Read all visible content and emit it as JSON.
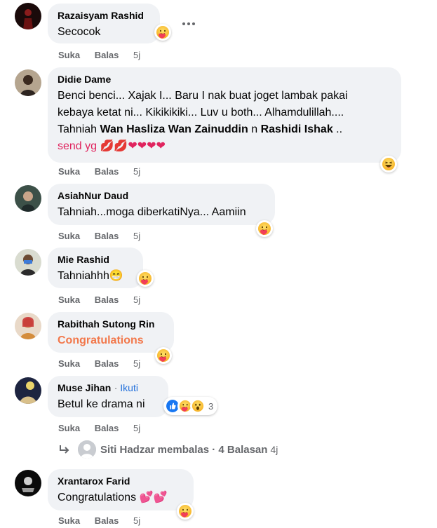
{
  "actions": {
    "like": "Suka",
    "reply": "Balas"
  },
  "comments": [
    {
      "author": "Razaisyam Rashid",
      "text": "Secocok",
      "time": "5j",
      "reaction": "care"
    },
    {
      "author": "Didie Dame",
      "text_lines": [
        "Benci benci... Xajak I... Baru I nak buat joget lambak pakai",
        "kebaya ketat ni... Kikikikiki... Luv u both... Alhamdulillah....",
        "Tahniah ",
        "Wan Hasliza Wan Zainuddin",
        " n ",
        "Rashidi Ishak",
        " ..",
        "send yg 💋💋❤❤❤❤"
      ],
      "time": "5j",
      "reaction": "haha"
    },
    {
      "author": "AsiahNur Daud",
      "text": "Tahniah...moga diberkatiNya... Aamiin",
      "time": "5j",
      "reaction": "care"
    },
    {
      "author": "Mie Rashid",
      "text": "Tahniahhh😁",
      "time": "5j",
      "reaction": "care"
    },
    {
      "author": "Rabithah Sutong Rin",
      "text": "Congratulations",
      "time": "5j",
      "reaction": "care"
    },
    {
      "author": "Muse Jihan",
      "follow": "Ikuti",
      "text": "Betul ke drama ni",
      "time": "5j",
      "reaction_count": "3"
    },
    {
      "author": "Xrantarox Farid",
      "text": "Congratulations 💕💕",
      "time": "5j",
      "reaction": "care"
    }
  ],
  "reply_summary": {
    "text": "Siti Hadzar membalas · 4 Balasan",
    "time": "4j"
  },
  "colors": {
    "bubble": "#f0f2f5",
    "meta": "#65676b",
    "link": "#216fdb",
    "congrats": "#f2784b"
  }
}
